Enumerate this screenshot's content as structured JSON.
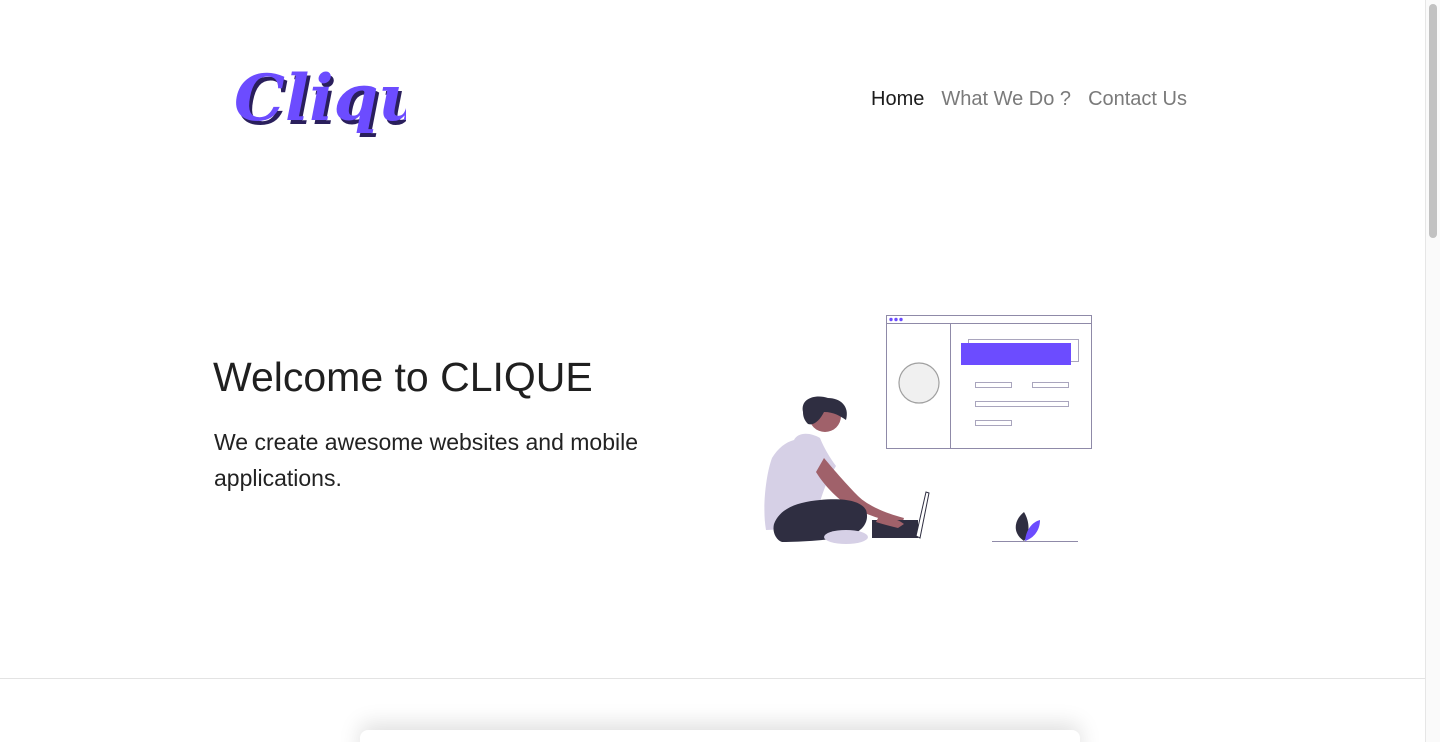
{
  "brand": {
    "logo_text": "Clique",
    "accent_color": "#6c4cff"
  },
  "nav": {
    "items": [
      {
        "label": "Home",
        "active": true
      },
      {
        "label": "What We Do ?",
        "active": false
      },
      {
        "label": "Contact Us",
        "active": false
      }
    ]
  },
  "hero": {
    "title": "Welcome to CLIQUE",
    "subtitle": "We create awesome websites and mobile applications.",
    "illustration_icon": "person-with-laptop-illustration"
  }
}
